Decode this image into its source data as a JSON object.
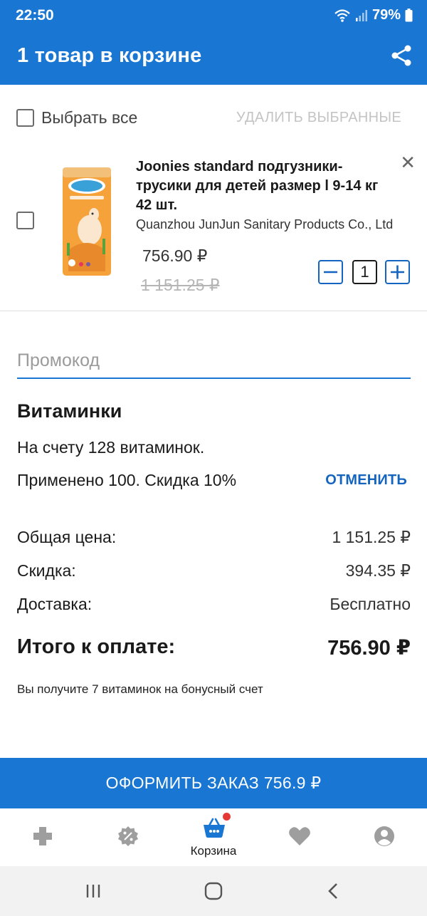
{
  "status_bar": {
    "time": "22:50",
    "battery": "79%"
  },
  "header": {
    "title": "1 товар в корзине",
    "share_icon": "share-icon"
  },
  "selection": {
    "select_all_label": "Выбрать все",
    "delete_selected_label": "УДАЛИТЬ ВЫБРАННЫЕ"
  },
  "cart_item": {
    "name": "Joonies standard подгузники-трусики для детей размер l 9-14 кг 42 шт.",
    "manufacturer": "Quanzhou JunJun Sanitary Products Co., Ltd",
    "price": "756.90 ₽",
    "old_price": "1 151.25 ₽",
    "quantity": "1",
    "image_icon": "diaper-package-image"
  },
  "promo": {
    "placeholder": "Промокод"
  },
  "vitamins": {
    "title": "Витаминки",
    "balance_text": "На счету 128 витаминок.",
    "applied_text": "Применено 100. Скидка 10%",
    "cancel_label": "ОТМЕНИТЬ"
  },
  "summary": {
    "total_price_label": "Общая цена:",
    "total_price_value": "1 151.25 ₽",
    "discount_label": "Скидка:",
    "discount_value": "394.35 ₽",
    "delivery_label": "Доставка:",
    "delivery_value": "Бесплатно",
    "to_pay_label": "Итого к оплате:",
    "to_pay_value": "756.90 ₽",
    "bonus_text": "Вы получите 7 витаминок на бонусный счет"
  },
  "checkout": {
    "label": "ОФОРМИТЬ ЗАКАЗ 756.9 ₽"
  },
  "bottom_nav": {
    "items": [
      {
        "icon": "medical-cross-icon",
        "label": ""
      },
      {
        "icon": "discount-badge-icon",
        "label": ""
      },
      {
        "icon": "basket-icon",
        "label": "Корзина",
        "active": true
      },
      {
        "icon": "heart-icon",
        "label": ""
      },
      {
        "icon": "profile-icon",
        "label": ""
      }
    ]
  },
  "colors": {
    "primary": "#1976d2",
    "accent_text": "#1565c0",
    "badge": "#e53935",
    "nav_icon": "#9e9e9e"
  }
}
